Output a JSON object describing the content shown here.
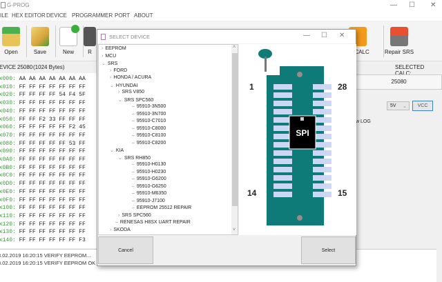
{
  "app": {
    "title": "G-PROG",
    "window_controls": [
      "—",
      "☐",
      "✕"
    ]
  },
  "menu": [
    "ILE",
    "HEX EDITOR",
    "DEVICE",
    "PROGRAMMER",
    "PORT",
    "ABOUT"
  ],
  "toolbar": {
    "open": "Open",
    "save": "Save",
    "new": "New",
    "read": "R",
    "select_calc": "ct CALC",
    "repair_srs": "Repair SRS"
  },
  "device_bar": {
    "device_label": "EVICE",
    "device": "25080",
    "size": "(1024 Bytes)",
    "selected_calc_label": "SELECTED CALC:"
  },
  "hex": {
    "rows": [
      {
        "addr": "0x000:",
        "bytes": [
          "AA",
          "AA",
          "AA",
          "AA",
          "AA",
          "AA",
          "AA"
        ]
      },
      {
        "addr": "0x010:",
        "bytes": [
          "FF",
          "FF",
          "FF",
          "FF",
          "FF",
          "FF",
          "FF"
        ]
      },
      {
        "addr": "0x020:",
        "bytes": [
          "FF",
          "FF",
          "FF",
          "FF",
          "54",
          "F4",
          "5F"
        ]
      },
      {
        "addr": "0x030:",
        "bytes": [
          "FF",
          "FF",
          "FF",
          "FF",
          "FF",
          "FF",
          "FF"
        ]
      },
      {
        "addr": "0x040:",
        "bytes": [
          "FF",
          "FF",
          "FF",
          "FF",
          "FF",
          "FF",
          "FF"
        ]
      },
      {
        "addr": "0x050:",
        "bytes": [
          "FF",
          "FF",
          "F2",
          "33",
          "FF",
          "FF",
          "FF"
        ]
      },
      {
        "addr": "0x060:",
        "bytes": [
          "FF",
          "FF",
          "FF",
          "FF",
          "FF",
          "F2",
          "45"
        ]
      },
      {
        "addr": "0x070:",
        "bytes": [
          "FF",
          "FF",
          "FF",
          "FF",
          "FF",
          "FF",
          "FF"
        ]
      },
      {
        "addr": "0x080:",
        "bytes": [
          "FF",
          "FF",
          "FF",
          "FF",
          "FF",
          "53",
          "FF"
        ]
      },
      {
        "addr": "0x090:",
        "bytes": [
          "FF",
          "FF",
          "FF",
          "FF",
          "FF",
          "FF",
          "FF"
        ]
      },
      {
        "addr": "0x0A0:",
        "bytes": [
          "FF",
          "FF",
          "FF",
          "FF",
          "FF",
          "FF",
          "FF"
        ]
      },
      {
        "addr": "0x0B0:",
        "bytes": [
          "FF",
          "FF",
          "FF",
          "FF",
          "FF",
          "FF",
          "FF"
        ]
      },
      {
        "addr": "0x0C0:",
        "bytes": [
          "FF",
          "FF",
          "FF",
          "FF",
          "FF",
          "FF",
          "FF"
        ]
      },
      {
        "addr": "0x0D0:",
        "bytes": [
          "FF",
          "FF",
          "FF",
          "FF",
          "FF",
          "FF",
          "FF"
        ]
      },
      {
        "addr": "0x0E0:",
        "bytes": [
          "FF",
          "FF",
          "FF",
          "FF",
          "FF",
          "FF",
          "FF"
        ]
      },
      {
        "addr": "0x0F0:",
        "bytes": [
          "FF",
          "FF",
          "FF",
          "FF",
          "FF",
          "FF",
          "FF"
        ]
      },
      {
        "addr": "0x100:",
        "bytes": [
          "FF",
          "FF",
          "FF",
          "FF",
          "FF",
          "FF",
          "FF"
        ]
      },
      {
        "addr": "0x110:",
        "bytes": [
          "FF",
          "FF",
          "FF",
          "FF",
          "FF",
          "FF",
          "FF"
        ]
      },
      {
        "addr": "0x120:",
        "bytes": [
          "FF",
          "FF",
          "FF",
          "FF",
          "FF",
          "FF",
          "FF"
        ]
      },
      {
        "addr": "0x130:",
        "bytes": [
          "FF",
          "FF",
          "FF",
          "FF",
          "FF",
          "FF",
          "FF"
        ]
      },
      {
        "addr": "0x140:",
        "bytes": [
          "FF",
          "FF",
          "FF",
          "FF",
          "FF",
          "FF",
          "F3"
        ]
      }
    ]
  },
  "log": [
    "3.02.2019 16:20:15   VERIFY EEPROM...",
    "3.02.2019 16:20:15   VERIFY EEPROM OK"
  ],
  "right_panel": {
    "selected_calc": "25080",
    "voltage": "5V",
    "vcc_button": "VCC",
    "log_label": "w LOG"
  },
  "dialog": {
    "title": "SELECT DEVICE",
    "cancel": "Cancel",
    "select": "Select",
    "tree": [
      {
        "label": "EEPROM",
        "level": 0,
        "state": "collapsed"
      },
      {
        "label": "MCU",
        "level": 0,
        "state": "collapsed"
      },
      {
        "label": "SRS",
        "level": 0,
        "state": "expanded"
      },
      {
        "label": "FORD",
        "level": 1,
        "state": "collapsed"
      },
      {
        "label": "HONDA / ACURA",
        "level": 1,
        "state": "collapsed"
      },
      {
        "label": "HYUNDAI",
        "level": 1,
        "state": "expanded"
      },
      {
        "label": "SRS V850",
        "level": 2,
        "state": "collapsed"
      },
      {
        "label": "SRS SPC560",
        "level": 2,
        "state": "expanded"
      },
      {
        "label": "95910-3N500",
        "level": 3,
        "state": "leaf"
      },
      {
        "label": "95910-3N700",
        "level": 3,
        "state": "leaf"
      },
      {
        "label": "95910-C7010",
        "level": 3,
        "state": "leaf"
      },
      {
        "label": "95910-C8000",
        "level": 3,
        "state": "leaf"
      },
      {
        "label": "95910-C8100",
        "level": 3,
        "state": "leaf"
      },
      {
        "label": "95910-C8200",
        "level": 3,
        "state": "leaf"
      },
      {
        "label": "KIA",
        "level": 1,
        "state": "expanded"
      },
      {
        "label": "SRS RH850",
        "level": 2,
        "state": "expanded"
      },
      {
        "label": "95910-H0130",
        "level": 3,
        "state": "leaf"
      },
      {
        "label": "95910-H0230",
        "level": 3,
        "state": "leaf"
      },
      {
        "label": "95910-G6200",
        "level": 3,
        "state": "leaf"
      },
      {
        "label": "95910-G6250",
        "level": 3,
        "state": "leaf"
      },
      {
        "label": "95910-M6350",
        "level": 3,
        "state": "leaf"
      },
      {
        "label": "95910-J7100",
        "level": 3,
        "state": "leaf"
      },
      {
        "label": "EEPROM 25512 REPAIR",
        "level": 3,
        "state": "leaf"
      },
      {
        "label": "SRS SPC560",
        "level": 2,
        "state": "collapsed"
      },
      {
        "label": "RENESAS H8SX UART REPAIR",
        "level": 1,
        "state": "leaf"
      },
      {
        "label": "SKODA",
        "level": 1,
        "state": "collapsed"
      }
    ],
    "chip": {
      "label": "SPI",
      "pin_top_left": "1",
      "pin_top_right": "28",
      "pin_bottom_left": "14",
      "pin_bottom_right": "15"
    }
  },
  "colors": {
    "socket": "#0e7b78",
    "pad": "#ccd6f5",
    "address": "#3a9a3a",
    "vcc_border": "#3c7fd6"
  }
}
